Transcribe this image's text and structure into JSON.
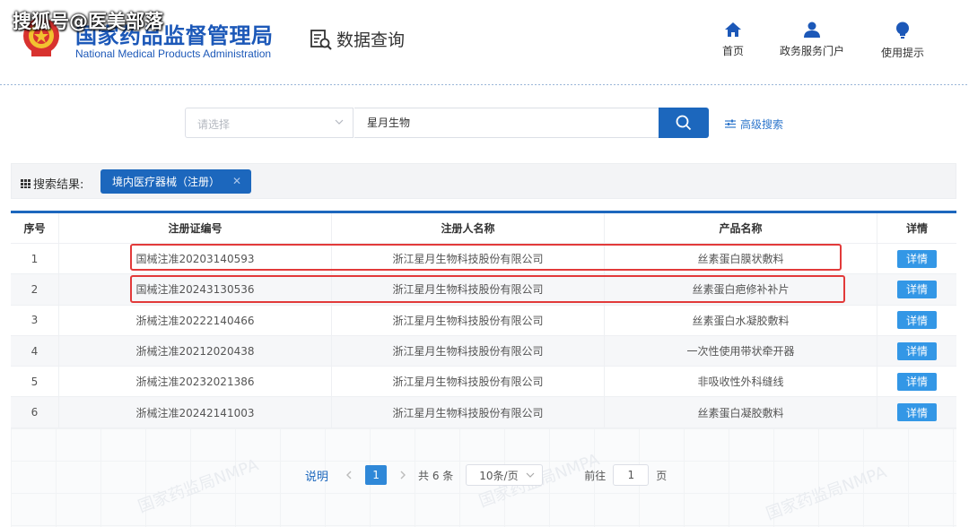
{
  "watermark": "搜狐号@医美部落",
  "header": {
    "org_name_cn": "国家药品监督管理局",
    "org_name_en": "National Medical Products Administration",
    "system_title": "数据查询",
    "nav": [
      {
        "label": "首页",
        "icon": "home-icon"
      },
      {
        "label": "政务服务门户",
        "icon": "user-icon"
      },
      {
        "label": "使用提示",
        "icon": "lightbulb-icon"
      }
    ]
  },
  "search": {
    "select_placeholder": "请选择",
    "query": "星月生物",
    "advanced_label": "高级搜索"
  },
  "results": {
    "label": "搜索结果:",
    "tag": "境内医疗器械（注册）"
  },
  "table": {
    "headers": [
      "序号",
      "注册证编号",
      "注册人名称",
      "产品名称",
      "详情"
    ],
    "detail_label": "详情",
    "rows": [
      {
        "no": "1",
        "cert": "国械注准20203140593",
        "registrant": "浙江星月生物科技股份有限公司",
        "product": "丝素蛋白膜状敷料",
        "highlighted": true
      },
      {
        "no": "2",
        "cert": "国械注准20243130536",
        "registrant": "浙江星月生物科技股份有限公司",
        "product": "丝素蛋白疤修补补片",
        "highlighted": true
      },
      {
        "no": "3",
        "cert": "浙械注准20222140466",
        "registrant": "浙江星月生物科技股份有限公司",
        "product": "丝素蛋白水凝胶敷料",
        "highlighted": false
      },
      {
        "no": "4",
        "cert": "浙械注准20212020438",
        "registrant": "浙江星月生物科技股份有限公司",
        "product": "一次性使用带状牵开器",
        "highlighted": false
      },
      {
        "no": "5",
        "cert": "浙械注准20232021386",
        "registrant": "浙江星月生物科技股份有限公司",
        "product": "非吸收性外科缝线",
        "highlighted": false
      },
      {
        "no": "6",
        "cert": "浙械注准20242141003",
        "registrant": "浙江星月生物科技股份有限公司",
        "product": "丝素蛋白凝胶敷料",
        "highlighted": false
      }
    ]
  },
  "pagination": {
    "explain": "说明",
    "current_page": "1",
    "total": "共 6 条",
    "page_size": "10条/页",
    "goto_label": "前往",
    "goto_value": "1",
    "page_suffix": "页"
  },
  "bg_watermark": "国家药监局NMPA",
  "colors": {
    "brand": "#1c67bd",
    "highlight": "#e23a3a",
    "detail_button": "#3397e6"
  }
}
